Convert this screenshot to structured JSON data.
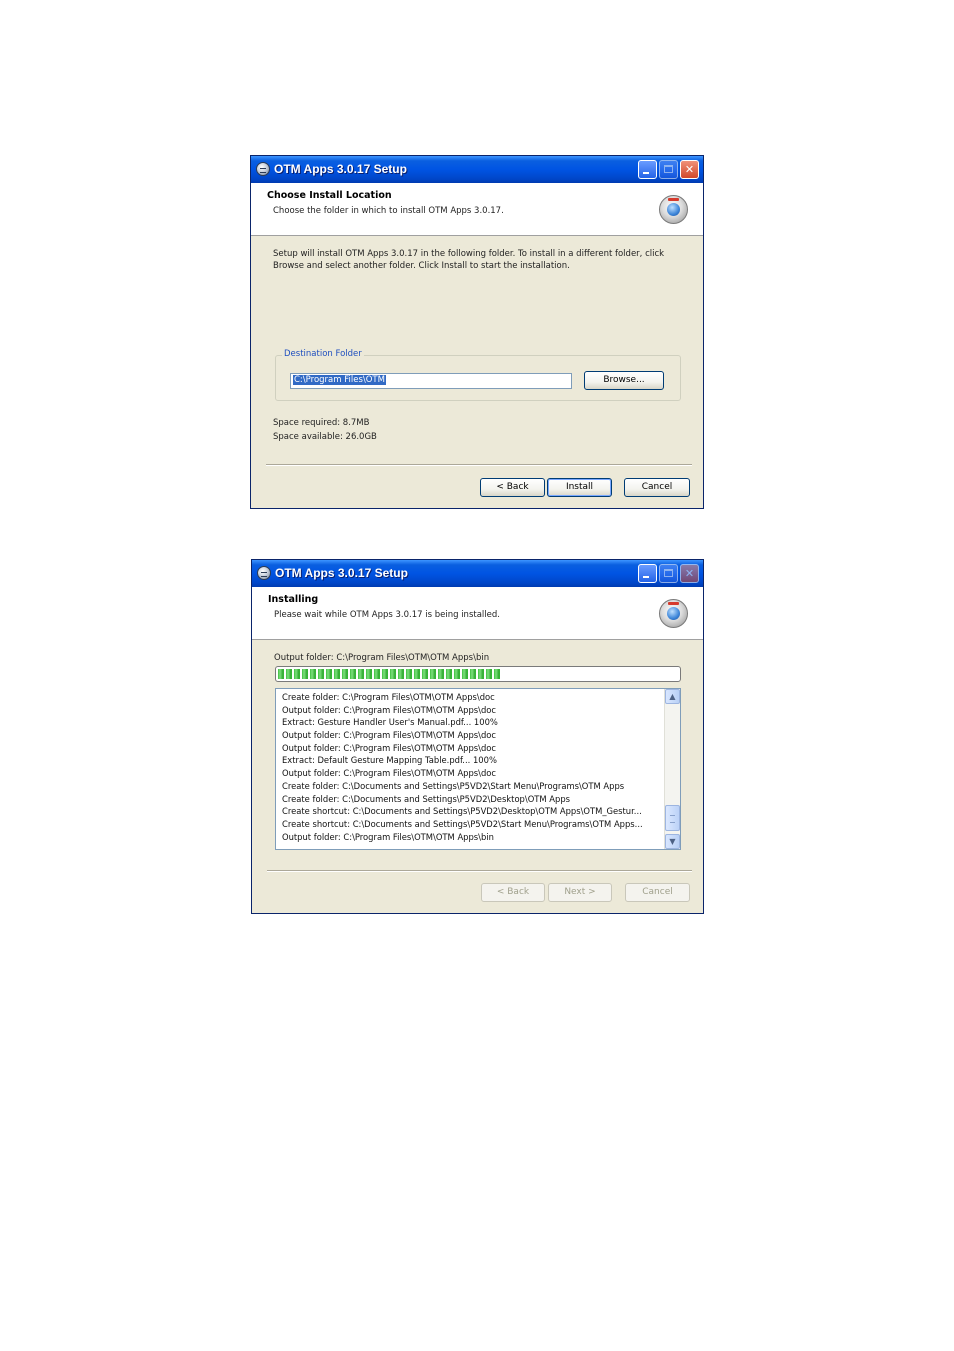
{
  "window1": {
    "title": "OTM Apps 3.0.17 Setup",
    "header_title": "Choose Install Location",
    "header_subtitle": "Choose the folder in which to install OTM Apps 3.0.17.",
    "description_line1": "Setup will install OTM Apps 3.0.17 in the following folder. To install in a different folder, click",
    "description_line2": "Browse and select another folder. Click Install to start the installation.",
    "destination_group_label": "Destination Folder",
    "destination_path": "C:\\Program Files\\OTM",
    "browse_label": "Browse...",
    "space_required": "Space required: 8.7MB",
    "space_available": "Space available: 26.0GB",
    "back_label": "< Back",
    "install_label": "Install",
    "cancel_label": "Cancel"
  },
  "window2": {
    "title": "OTM Apps 3.0.17 Setup",
    "header_title": "Installing",
    "header_subtitle": "Please wait while OTM Apps 3.0.17 is being installed.",
    "status": "Output folder: C:\\Program Files\\OTM\\OTM Apps\\bin",
    "progress_fraction": 0.56,
    "log": [
      "Create folder: C:\\Program Files\\OTM\\OTM Apps\\doc",
      "Output folder: C:\\Program Files\\OTM\\OTM Apps\\doc",
      "Extract: Gesture Handler User's Manual.pdf... 100%",
      "Output folder: C:\\Program Files\\OTM\\OTM Apps\\doc",
      "Output folder: C:\\Program Files\\OTM\\OTM Apps\\doc",
      "Extract: Default Gesture Mapping Table.pdf... 100%",
      "Output folder: C:\\Program Files\\OTM\\OTM Apps\\doc",
      "Create folder: C:\\Documents and Settings\\P5VD2\\Start Menu\\Programs\\OTM Apps",
      "Create folder: C:\\Documents and Settings\\P5VD2\\Desktop\\OTM Apps",
      "Create shortcut: C:\\Documents and Settings\\P5VD2\\Desktop\\OTM Apps\\OTM_Gestur...",
      "Create shortcut: C:\\Documents and Settings\\P5VD2\\Start Menu\\Programs\\OTM Apps...",
      "Output folder: C:\\Program Files\\OTM\\OTM Apps\\bin"
    ],
    "back_label": "< Back",
    "next_label": "Next >",
    "cancel_label": "Cancel"
  },
  "icons": [
    "app-icon",
    "minimize-icon",
    "maximize-icon",
    "close-icon",
    "installer-badge-icon",
    "scroll-up-icon",
    "scroll-down-icon"
  ],
  "colors": {
    "titlebar": "#0054e3",
    "dialog_bg": "#ece9d8",
    "progress": "#3fbf3f",
    "selection": "#316ac5"
  }
}
